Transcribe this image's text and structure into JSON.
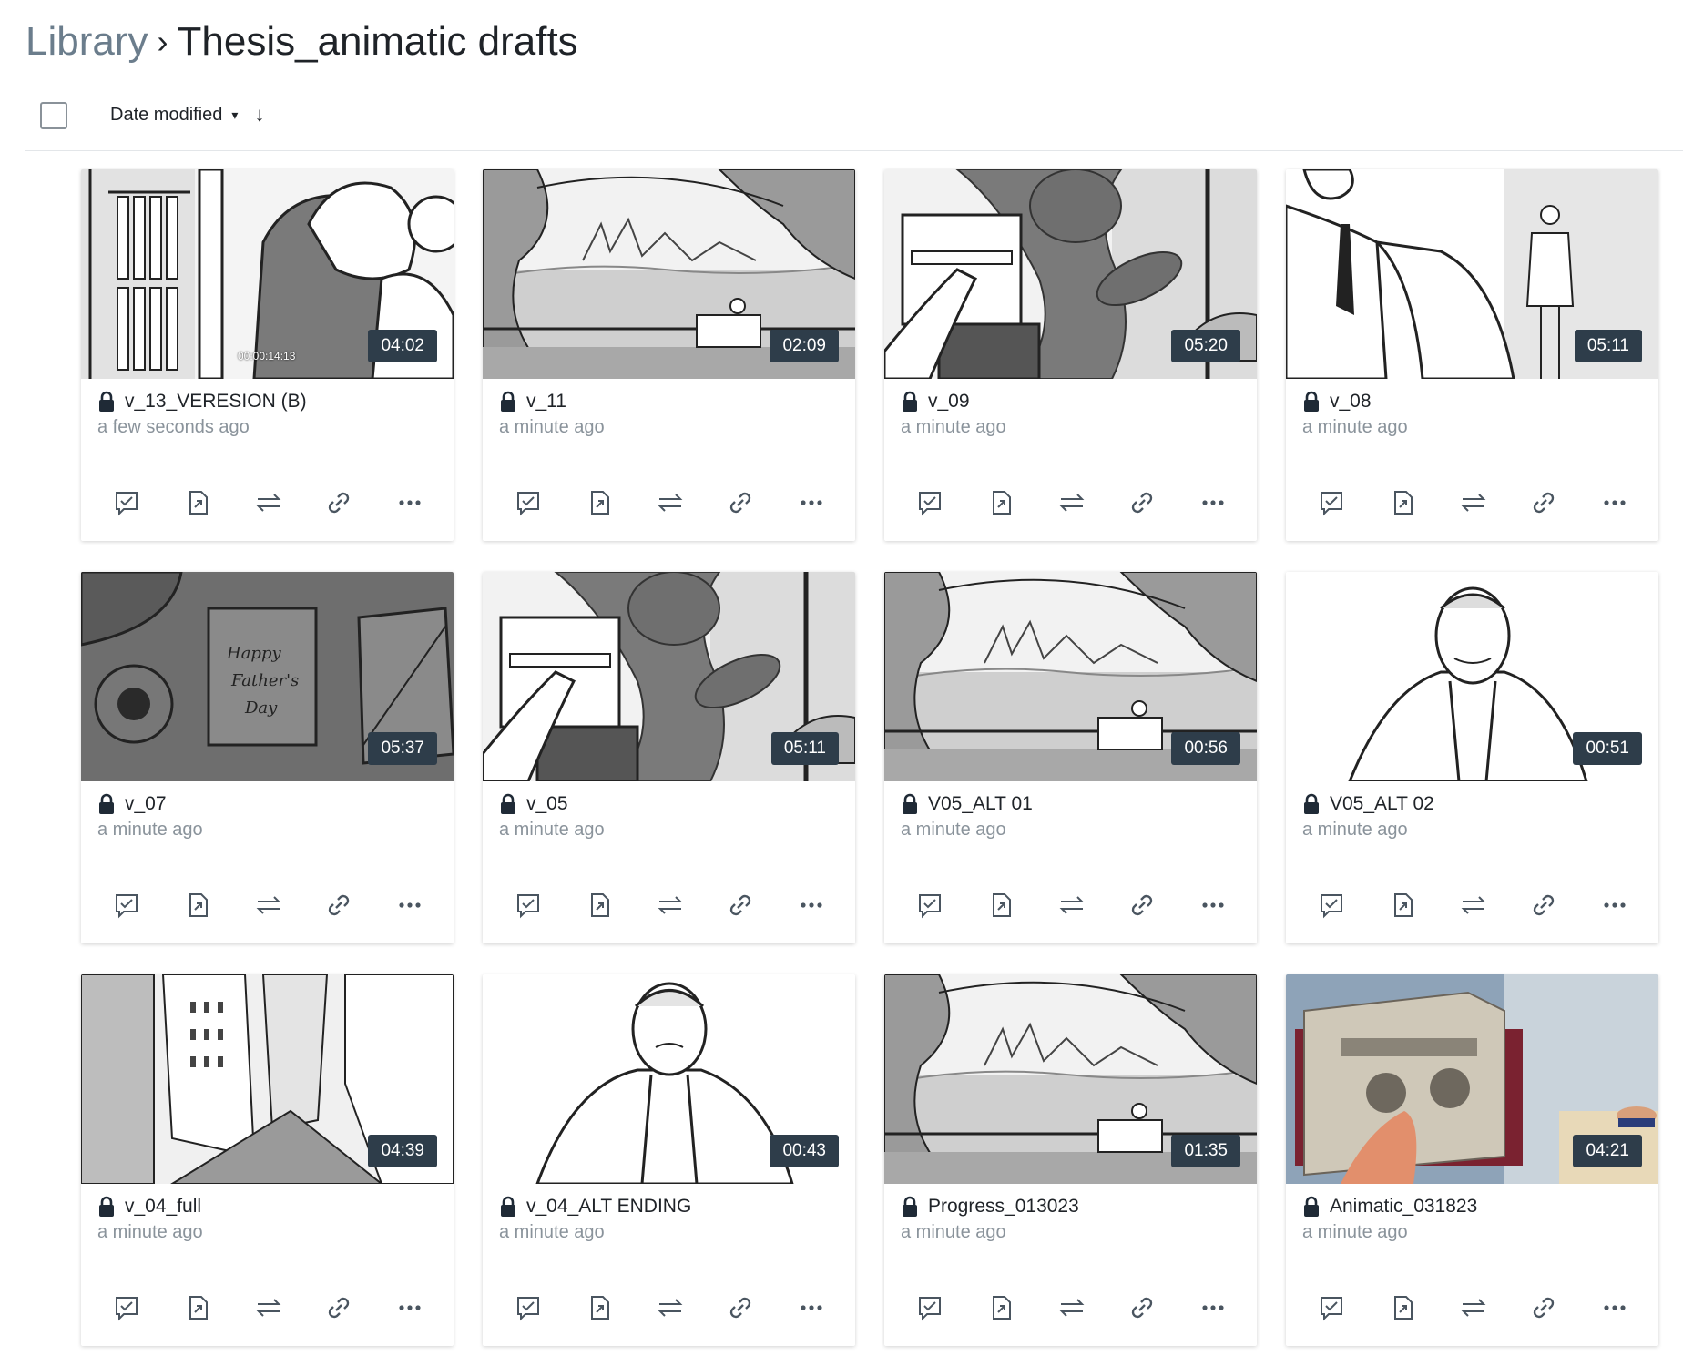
{
  "breadcrumb": {
    "root": "Library",
    "separator": "›",
    "current": "Thesis_animatic drafts"
  },
  "toolbar": {
    "sort_label": "Date modified",
    "sort_chevron": "▾",
    "sort_direction": "↓"
  },
  "action_icons": [
    "review-icon",
    "open-external-icon",
    "transfer-icon",
    "link-icon",
    "more-icon"
  ],
  "cards": [
    {
      "title": "v_13_VERESION (B)",
      "time": "a few seconds ago",
      "duration": "04:02",
      "timecode": "00:00:14:13",
      "scene": "closet"
    },
    {
      "title": "v_11",
      "time": "a minute ago",
      "duration": "02:09",
      "scene": "park"
    },
    {
      "title": "v_09",
      "time": "a minute ago",
      "duration": "05:20",
      "scene": "radio"
    },
    {
      "title": "v_08",
      "time": "a minute ago",
      "duration": "05:11",
      "scene": "suit"
    },
    {
      "title": "v_07",
      "time": "a minute ago",
      "duration": "05:37",
      "scene": "card"
    },
    {
      "title": "v_05",
      "time": "a minute ago",
      "duration": "05:11",
      "scene": "radio"
    },
    {
      "title": "V05_ALT 01",
      "time": "a minute ago",
      "duration": "00:56",
      "scene": "park"
    },
    {
      "title": "V05_ALT 02",
      "time": "a minute ago",
      "duration": "00:51",
      "scene": "oldman"
    },
    {
      "title": "v_04_full",
      "time": "a minute ago",
      "duration": "04:39",
      "scene": "city"
    },
    {
      "title": "v_04_ALT ENDING",
      "time": "a minute ago",
      "duration": "00:43",
      "scene": "oldman2"
    },
    {
      "title": "Progress_013023",
      "time": "a minute ago",
      "duration": "01:35",
      "scene": "park"
    },
    {
      "title": "Animatic_031823",
      "time": "a minute ago",
      "duration": "04:21",
      "scene": "color"
    }
  ]
}
